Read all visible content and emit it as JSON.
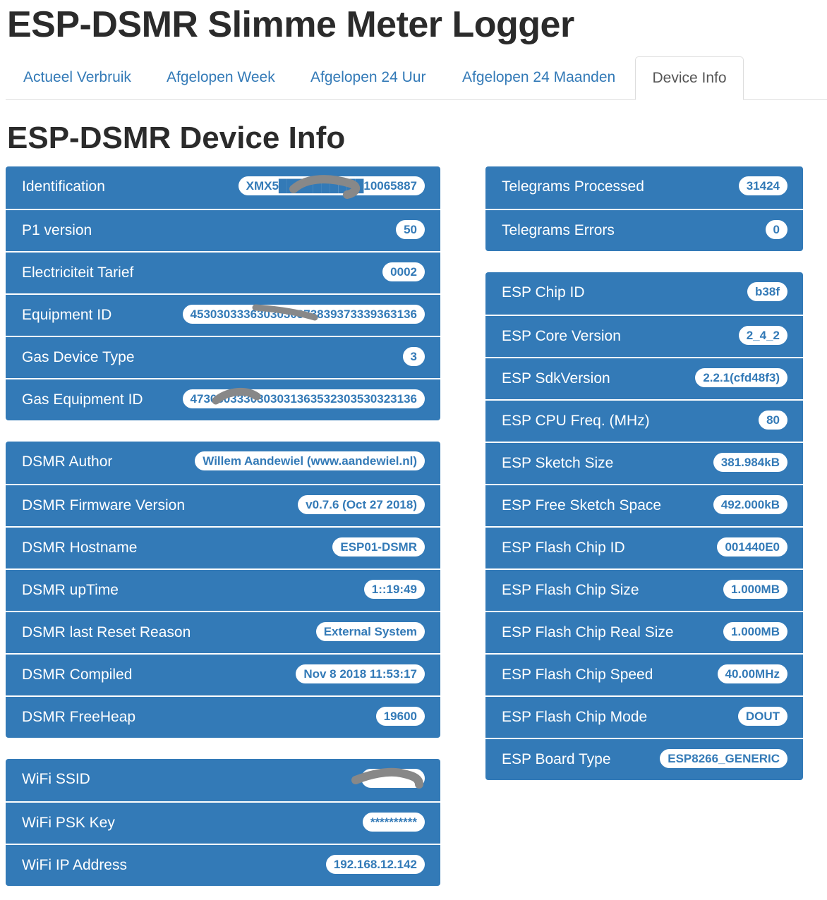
{
  "app": {
    "title": "ESP-DSMR Slimme Meter Logger"
  },
  "tabs": [
    {
      "label": "Actueel Verbruik",
      "active": false
    },
    {
      "label": "Afgelopen Week",
      "active": false
    },
    {
      "label": "Afgelopen 24 Uur",
      "active": false
    },
    {
      "label": "Afgelopen 24 Maanden",
      "active": false
    },
    {
      "label": "Device Info",
      "active": true
    }
  ],
  "page": {
    "title": "ESP-DSMR Device Info"
  },
  "meter": [
    {
      "label": "Identification",
      "value": "XMX5██████████10065887"
    },
    {
      "label": "P1 version",
      "value": "50"
    },
    {
      "label": "Electriciteit Tarief",
      "value": "0002"
    },
    {
      "label": "Equipment ID",
      "value": "4530303336303030373839373339363136"
    },
    {
      "label": "Gas Device Type",
      "value": "3"
    },
    {
      "label": "Gas Equipment ID",
      "value": "4730303330303031363532303530323136"
    }
  ],
  "dsmr": [
    {
      "label": "DSMR Author",
      "value": "Willem Aandewiel (www.aandewiel.nl)"
    },
    {
      "label": "DSMR Firmware Version",
      "value": "v0.7.6 (Oct 27 2018)"
    },
    {
      "label": "DSMR Hostname",
      "value": "ESP01-DSMR"
    },
    {
      "label": "DSMR upTime",
      "value": "1::19:49"
    },
    {
      "label": "DSMR last Reset Reason",
      "value": "External System"
    },
    {
      "label": "DSMR Compiled",
      "value": "Nov 8 2018 11:53:17"
    },
    {
      "label": "DSMR FreeHeap",
      "value": "19600"
    }
  ],
  "wifi": [
    {
      "label": "WiFi SSID",
      "value": " "
    },
    {
      "label": "WiFi PSK Key",
      "value": "**********"
    },
    {
      "label": "WiFi IP Address",
      "value": "192.168.12.142"
    }
  ],
  "telegrams": [
    {
      "label": "Telegrams Processed",
      "value": "31424"
    },
    {
      "label": "Telegrams Errors",
      "value": "0"
    }
  ],
  "esp": [
    {
      "label": "ESP Chip ID",
      "value": "b38f"
    },
    {
      "label": "ESP Core Version",
      "value": "2_4_2"
    },
    {
      "label": "ESP SdkVersion",
      "value": "2.2.1(cfd48f3)"
    },
    {
      "label": "ESP CPU Freq. (MHz)",
      "value": "80"
    },
    {
      "label": "ESP Sketch Size",
      "value": "381.984kB"
    },
    {
      "label": "ESP Free Sketch Space",
      "value": "492.000kB"
    },
    {
      "label": "ESP Flash Chip ID",
      "value": "001440E0"
    },
    {
      "label": "ESP Flash Chip Size",
      "value": "1.000MB"
    },
    {
      "label": "ESP Flash Chip Real Size",
      "value": "1.000MB"
    },
    {
      "label": "ESP Flash Chip Speed",
      "value": "40.00MHz"
    },
    {
      "label": "ESP Flash Chip Mode",
      "value": "DOUT"
    },
    {
      "label": "ESP Board Type",
      "value": "ESP8266_GENERIC"
    }
  ],
  "colors": {
    "panel": "#337ab7",
    "badge_text": "#337ab7",
    "link": "#337ab7",
    "redaction": "#888888"
  }
}
